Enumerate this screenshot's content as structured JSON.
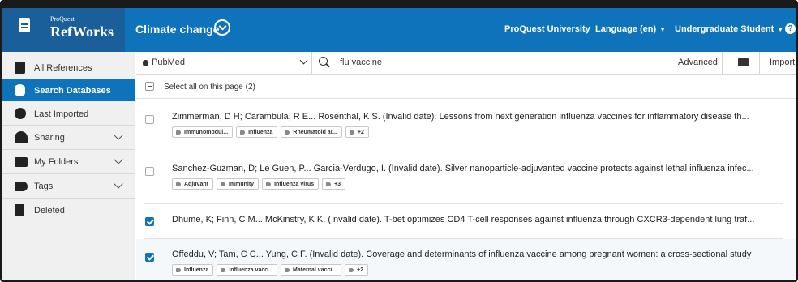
{
  "app": {
    "brand_small": "ProQuest",
    "brand": "RefWorks",
    "project": "Climate change",
    "institution": "ProQuest University",
    "language": "Language (en)",
    "user_role": "Undergraduate Student",
    "caret": "▼",
    "help": "?"
  },
  "sidebar": {
    "items": [
      {
        "label": "All References",
        "icon": "document-icon"
      },
      {
        "label": "Search Databases",
        "icon": "database-icon",
        "active": true
      },
      {
        "label": "Last Imported",
        "icon": "clock-icon"
      },
      {
        "label": "Sharing",
        "icon": "users-icon"
      },
      {
        "label": "My Folders",
        "icon": "folder-icon"
      },
      {
        "label": "Tags",
        "icon": "tag-icon"
      },
      {
        "label": "Deleted",
        "icon": "trash-icon"
      }
    ]
  },
  "search": {
    "database": "PubMed",
    "query": "flu vaccine",
    "advanced": "Advanced",
    "import": "Import"
  },
  "results": {
    "select_all": "Select all on this page (2)",
    "items": [
      {
        "title": "Zimmerman, D H; Carambula, R E... Rosenthal, K S. (Invalid date). Lessons from next generation influenza vaccines for inflammatory disease th...",
        "checked": false,
        "tags": [
          "Immunomodul...",
          "Influenza",
          "Rheumatoid ar...",
          "+2"
        ]
      },
      {
        "title": "Sanchez-Guzman, D; Le Guen, P... Garcia-Verdugo, I. (Invalid date). Silver nanoparticle-adjuvanted vaccine protects against lethal influenza infec...",
        "checked": false,
        "tags": [
          "Adjuvant",
          "Immunity",
          "Influenza virus",
          "+3"
        ]
      },
      {
        "title": "Dhume, K; Finn, C M... McKinstry, K K. (Invalid date). T-bet optimizes CD4 T-cell responses against influenza through CXCR3-dependent lung traf...",
        "checked": true,
        "tags": []
      },
      {
        "title": "Offeddu, V; Tam, C C... Yung, C F. (Invalid date). Coverage and determinants of influenza vaccine among pregnant women: a cross-sectional study",
        "checked": true,
        "tags": [
          "Influenza",
          "Influenza vacc...",
          "Maternal vacci...",
          "+2"
        ]
      }
    ]
  },
  "colors": {
    "accent": "#0e73ba",
    "logo_bg": "#1a5f99",
    "sidebar_bg": "#f0f0f0"
  }
}
